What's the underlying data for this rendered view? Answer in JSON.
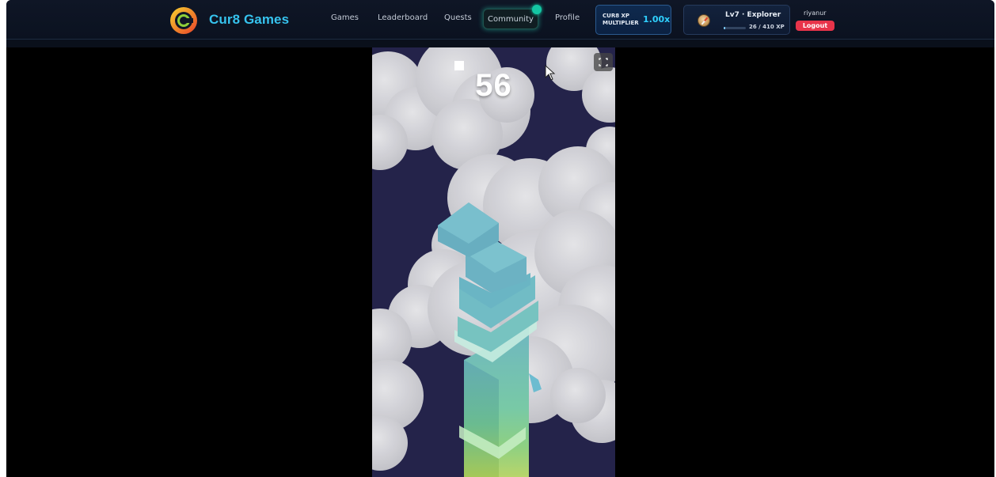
{
  "brand": {
    "name": "Cur8 Games",
    "logo_icon": "cur8-logo-icon"
  },
  "nav": {
    "games": "Games",
    "leaderboard": "Leaderboard",
    "quests": "Quests",
    "community": "Community",
    "profile": "Profile"
  },
  "xp_multiplier": {
    "label": "CUR8 XP MULTIPLIER",
    "value": "1.00x"
  },
  "level": {
    "label": "Lv7 · Explorer",
    "xp": "26 / 410 XP",
    "progress": 0.063
  },
  "user": {
    "name": "riyanur",
    "logout": "Logout"
  },
  "game": {
    "score": "56"
  },
  "colors": {
    "accent": "#36c3ee",
    "logout": "#e8344a",
    "notification": "#14c7a4",
    "sky": "#24234a"
  }
}
